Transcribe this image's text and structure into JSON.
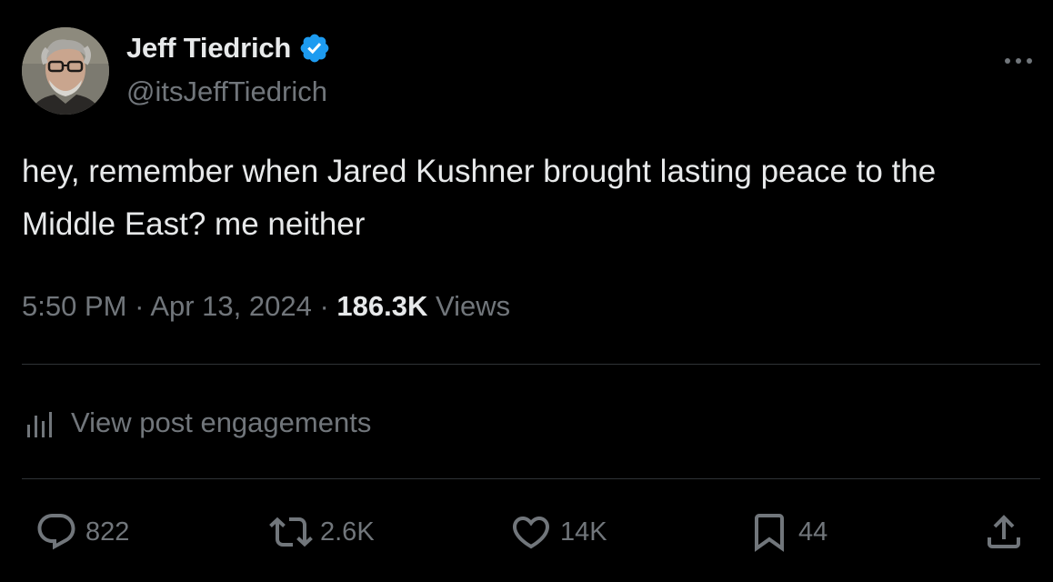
{
  "author": {
    "display_name": "Jeff Tiedrich",
    "handle": "@itsJeffTiedrich",
    "verified": true,
    "verified_color": "#1d9bf0"
  },
  "tweet": {
    "text": "hey, remember when Jared Kushner brought lasting peace to the Middle East? me neither",
    "time": "5:50 PM",
    "date": "Apr 13, 2024",
    "separator": "·",
    "views_count": "186.3K",
    "views_label": "Views"
  },
  "engagements_label": "View post engagements",
  "actions": {
    "replies": "822",
    "reposts": "2.6K",
    "likes": "14K",
    "bookmarks": "44"
  },
  "icons": {
    "verified": "verified-badge-icon",
    "more": "more-icon",
    "analytics": "analytics-bars-icon",
    "reply": "reply-icon",
    "repost": "repost-icon",
    "like": "heart-icon",
    "bookmark": "bookmark-icon",
    "share": "share-icon"
  },
  "colors": {
    "background": "#000000",
    "primary_text": "#e7e9ea",
    "secondary_text": "#71767b",
    "divider": "#2f3336"
  }
}
